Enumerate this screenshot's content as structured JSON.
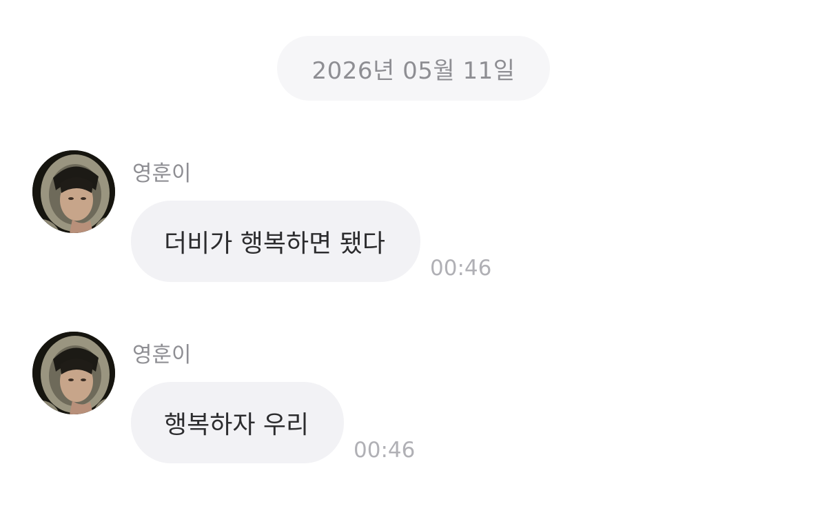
{
  "date_separator": "2026년 05월 11일",
  "messages": [
    {
      "sender": "영훈이",
      "text": "더비가 행복하면 됐다",
      "time": "00:46",
      "avatar_icon": "profile-photo"
    },
    {
      "sender": "영훈이",
      "text": "행복하자 우리",
      "time": "00:46",
      "avatar_icon": "profile-photo"
    }
  ],
  "colors": {
    "background": "#ffffff",
    "date_pill": "#f6f6f8",
    "bubble": "#f2f2f5",
    "muted_text": "#8e8e93",
    "message_text": "#2c2c2e",
    "time_text": "#b0b0b5"
  }
}
